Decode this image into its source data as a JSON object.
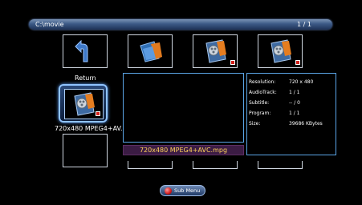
{
  "header": {
    "path": "C:\\movie",
    "page": "1 / 1"
  },
  "return_label": "Return",
  "selected_label": "720x480 MPEG4+AV..",
  "file_name": "720x480 MPEG4+AVC.mpg",
  "info": {
    "rows": [
      {
        "key": "Resolution:",
        "value": "720 x 480"
      },
      {
        "key": "AudioTrack:",
        "value": "1 / 1"
      },
      {
        "key": "Subtitle:",
        "value": "-- / 0"
      },
      {
        "key": "Program:",
        "value": "1 / 1"
      },
      {
        "key": "Size:",
        "value": "39686 KBytes"
      }
    ]
  },
  "submenu": {
    "label": "Sub Menu"
  },
  "icons": {
    "return": "return-arrow-icon",
    "folder": "folder-icon",
    "video": "video-file-icon",
    "badge": "red-checkbox-icon"
  },
  "colors": {
    "path_bar": "#3c5a86",
    "accent_border": "#5aa5e6",
    "filename_bg": "#3b1c44",
    "filename_text": "#ffd35a"
  }
}
